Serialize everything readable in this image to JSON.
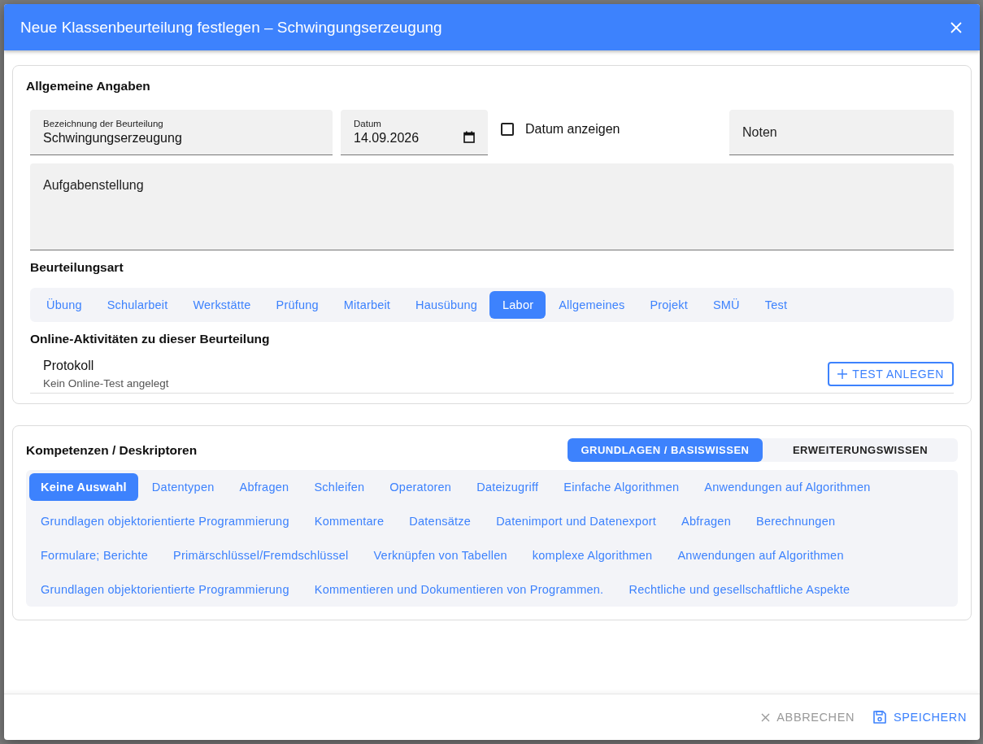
{
  "dialog": {
    "title": "Neue Klassenbeurteilung festlegen – Schwingungserzeugung"
  },
  "general": {
    "heading": "Allgemeine Angaben",
    "name_field": {
      "label": "Bezeichnung der Beurteilung",
      "value": "Schwingungserzeugung"
    },
    "date_field": {
      "label": "Datum",
      "value": "14.09.2026"
    },
    "show_date": {
      "label": "Datum anzeigen",
      "checked": false
    },
    "grades_field": {
      "placeholder": "Noten"
    },
    "task_field": {
      "placeholder": "Aufgabenstellung"
    },
    "type_heading": "Beurteilungsart",
    "types": [
      {
        "label": "Übung",
        "selected": false
      },
      {
        "label": "Schularbeit",
        "selected": false
      },
      {
        "label": "Werkstätte",
        "selected": false
      },
      {
        "label": "Prüfung",
        "selected": false
      },
      {
        "label": "Mitarbeit",
        "selected": false
      },
      {
        "label": "Hausübung",
        "selected": false
      },
      {
        "label": "Labor",
        "selected": true
      },
      {
        "label": "Allgemeines",
        "selected": false
      },
      {
        "label": "Projekt",
        "selected": false
      },
      {
        "label": "SMÜ",
        "selected": false
      },
      {
        "label": "Test",
        "selected": false
      }
    ],
    "online_heading": "Online-Aktivitäten zu dieser Beurteilung",
    "activity": {
      "title": "Protokoll",
      "subtitle": "Kein Online-Test angelegt",
      "button": "TEST ANLEGEN"
    }
  },
  "competences": {
    "heading": "Kompetenzen / Deskriptoren",
    "toggles": [
      {
        "label": "GRUNDLAGEN / BASISWISSEN",
        "selected": true
      },
      {
        "label": "ERWEITERUNGSWISSEN",
        "selected": false
      }
    ],
    "chips": [
      {
        "label": "Keine Auswahl",
        "selected": true
      },
      {
        "label": "Datentypen",
        "selected": false
      },
      {
        "label": "Abfragen",
        "selected": false
      },
      {
        "label": "Schleifen",
        "selected": false
      },
      {
        "label": "Operatoren",
        "selected": false
      },
      {
        "label": "Dateizugriff",
        "selected": false
      },
      {
        "label": "Einfache Algorithmen",
        "selected": false
      },
      {
        "label": "Anwendungen auf Algorithmen",
        "selected": false
      },
      {
        "label": "Grundlagen objektorientierte Programmierung",
        "selected": false
      },
      {
        "label": "Kommentare",
        "selected": false
      },
      {
        "label": "Datensätze",
        "selected": false
      },
      {
        "label": "Datenimport und Datenexport",
        "selected": false
      },
      {
        "label": "Abfragen",
        "selected": false
      },
      {
        "label": "Berechnungen",
        "selected": false
      },
      {
        "label": "Formulare; Berichte",
        "selected": false
      },
      {
        "label": "Primärschlüssel/Fremdschlüssel",
        "selected": false
      },
      {
        "label": "Verknüpfen von Tabellen",
        "selected": false
      },
      {
        "label": "komplexe Algorithmen",
        "selected": false
      },
      {
        "label": "Anwendungen auf Algorithmen",
        "selected": false
      },
      {
        "label": "Grundlagen objektorientierte Programmierung",
        "selected": false
      },
      {
        "label": "Kommentieren und Dokumentieren von Programmen.",
        "selected": false
      },
      {
        "label": "Rechtliche und gesellschaftliche Aspekte",
        "selected": false
      }
    ]
  },
  "footer": {
    "cancel": "ABBRECHEN",
    "save": "SPEICHERN"
  }
}
